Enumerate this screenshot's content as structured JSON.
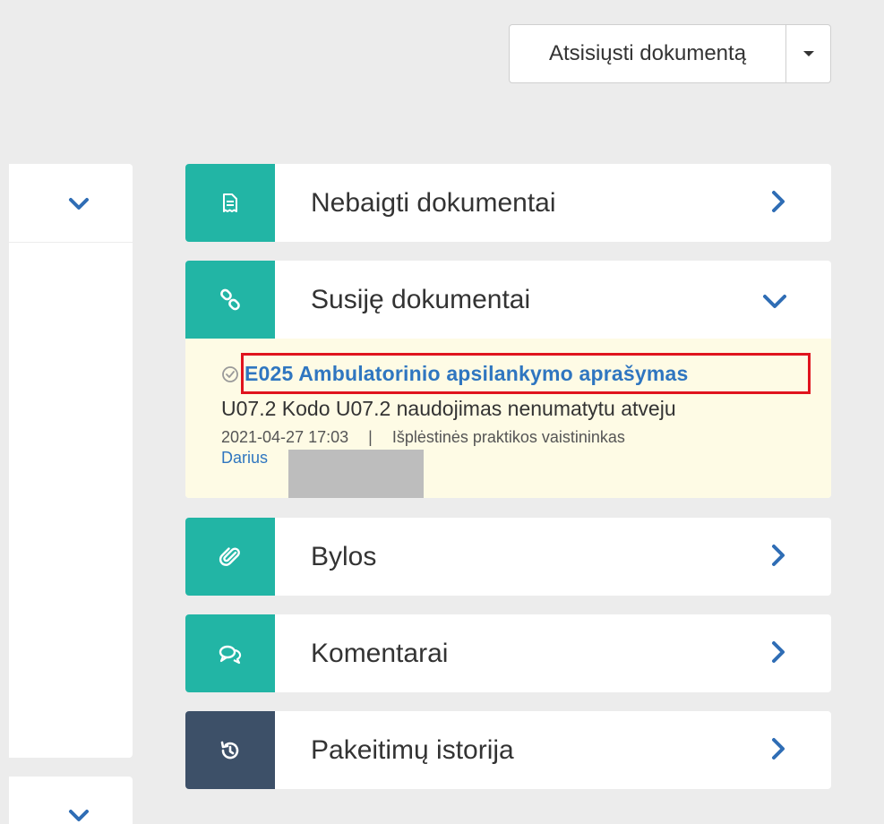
{
  "toolbar": {
    "download_label": "Atsisiųsti dokumentą"
  },
  "panels": {
    "unfinished": {
      "title": "Nebaigti dokumentai",
      "icon": "document-icon"
    },
    "related": {
      "title": "Susiję dokumentai",
      "icon": "link-icon",
      "item": {
        "link": "E025 Ambulatorinio apsilankymo aprašymas",
        "description": "U07.2 Kodo U07.2 naudojimas nenumatytu atveju",
        "datetime": "2021-04-27 17:03",
        "separator": "|",
        "role": "Išplėstinės praktikos vaistininkas",
        "author": "Darius"
      }
    },
    "files": {
      "title": "Bylos",
      "icon": "paperclip-icon"
    },
    "comments": {
      "title": "Komentarai",
      "icon": "comments-icon"
    },
    "history": {
      "title": "Pakeitimų istorija",
      "icon": "history-icon"
    }
  },
  "colors": {
    "teal": "#22b5a5",
    "dark_slate": "#3d5068",
    "link_blue": "#2f76c0",
    "highlight_red": "#e0141e",
    "related_bg": "#fefbe5"
  }
}
